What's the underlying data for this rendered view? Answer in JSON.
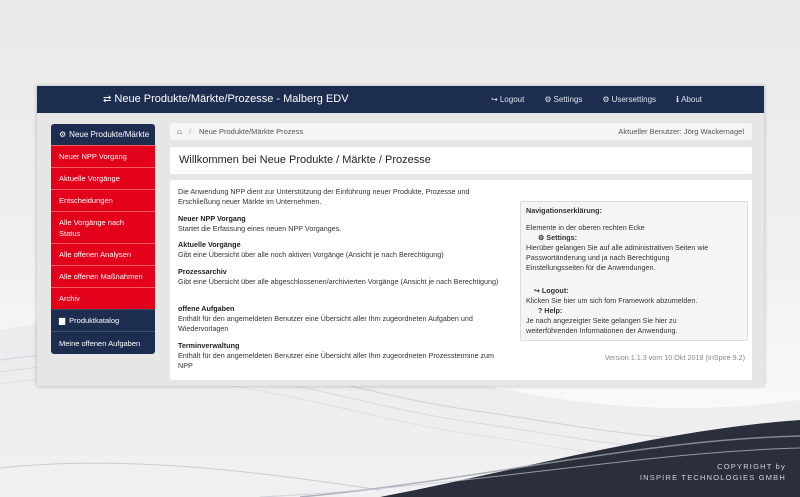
{
  "navbar": {
    "brand": "Neue Produkte/Märkte/Prozesse - Malberg EDV",
    "links": [
      {
        "icon": "logout-icon",
        "glyph": "↪",
        "label": "Logout"
      },
      {
        "icon": "gear-icon",
        "glyph": "⚙",
        "label": "Settings"
      },
      {
        "icon": "gear-icon",
        "glyph": "⚙",
        "label": "Usersettings"
      },
      {
        "icon": "info-icon",
        "glyph": "ℹ",
        "label": "About"
      }
    ]
  },
  "sidebar": {
    "head": "Neue Produkte/Märkte",
    "items_red": [
      {
        "label": "Neuer NPP Vorgang"
      },
      {
        "label": "Aktuelle Vorgänge"
      },
      {
        "label": "Entscheidungen"
      },
      {
        "label": "Alle Vorgänge nach Status"
      },
      {
        "label": "Alle offenen Analysen"
      },
      {
        "label": "Alle offenen Maßnahmen"
      },
      {
        "label": "Archiv"
      }
    ],
    "catalog": "Produktkatalog",
    "tasks": "Meine offenen Aufgaben"
  },
  "breadcrumb": {
    "sep": "/",
    "crumb": "Neue Produkte/Märkte Prozess",
    "user": "Aktueller Benutzer: Jörg Wackernagel"
  },
  "title": "Willkommen bei Neue Produkte / Märkte / Prozesse",
  "intro": "Die Anwendung NPP dient zur Unterstützung der Einführung neuer Produkte, Prozesse und Erschließung neuer Märkte im Unternehmen.",
  "sections": [
    {
      "title": "Neuer NPP Vorgang",
      "text": "Startet die Erfassung eines neuen NPP Vorganges."
    },
    {
      "title": "Aktuelle Vorgänge",
      "text": "Gibt eine Übersicht über alle noch aktiven Vorgänge (Ansicht je nach Berechtigung)"
    },
    {
      "title": "Prozessarchiv",
      "text": "Gibt eine Übersicht über alle abgeschlossenen/archivierten Vorgänge (Ansicht je nach Berechtigung)"
    },
    {
      "title": "offene Aufgaben",
      "text": "Enthält für den angemeldeten Benutzer eine Übersicht aller Ihm zugeordneten Aufgaben und Wiedervorlagen"
    },
    {
      "title": "Terminverwaltung",
      "text": "Enthält für den angemeldeten Benutzer eine Übersicht aller Ihm zugeordneten Prozesstermine zum NPP"
    }
  ],
  "navhelp": {
    "title": "Navigationserklärung:",
    "lead": "Elemente in der oberen rechten Ecke",
    "settings_title": "Settings:",
    "settings_lines": [
      "Hierüber gelangen Sie auf alle administrativen Seiten wie",
      "Passwortänderung und ja nach Berechtigung",
      "Einstellungsseiten für die Anwendungen."
    ],
    "logout_title": "Logout:",
    "logout_line": "Klicken Sie hier um sich fom Framework abzumelden.",
    "help_title": "Help:",
    "help_lines": [
      "Je nach angezeigter Seite gelangen Sie hier zu",
      "weiterführenden Informationen der Anwendung."
    ]
  },
  "version": "Version 1.1.3 vom 10.Okt 2018 (InSpire 9.2)",
  "copyright": {
    "line1": "COPYRIGHT by",
    "line2": "INSPIRE TECHNOLOGIES GMBH"
  },
  "colors": {
    "navy": "#1d2d4f",
    "red": "#e2001a"
  }
}
